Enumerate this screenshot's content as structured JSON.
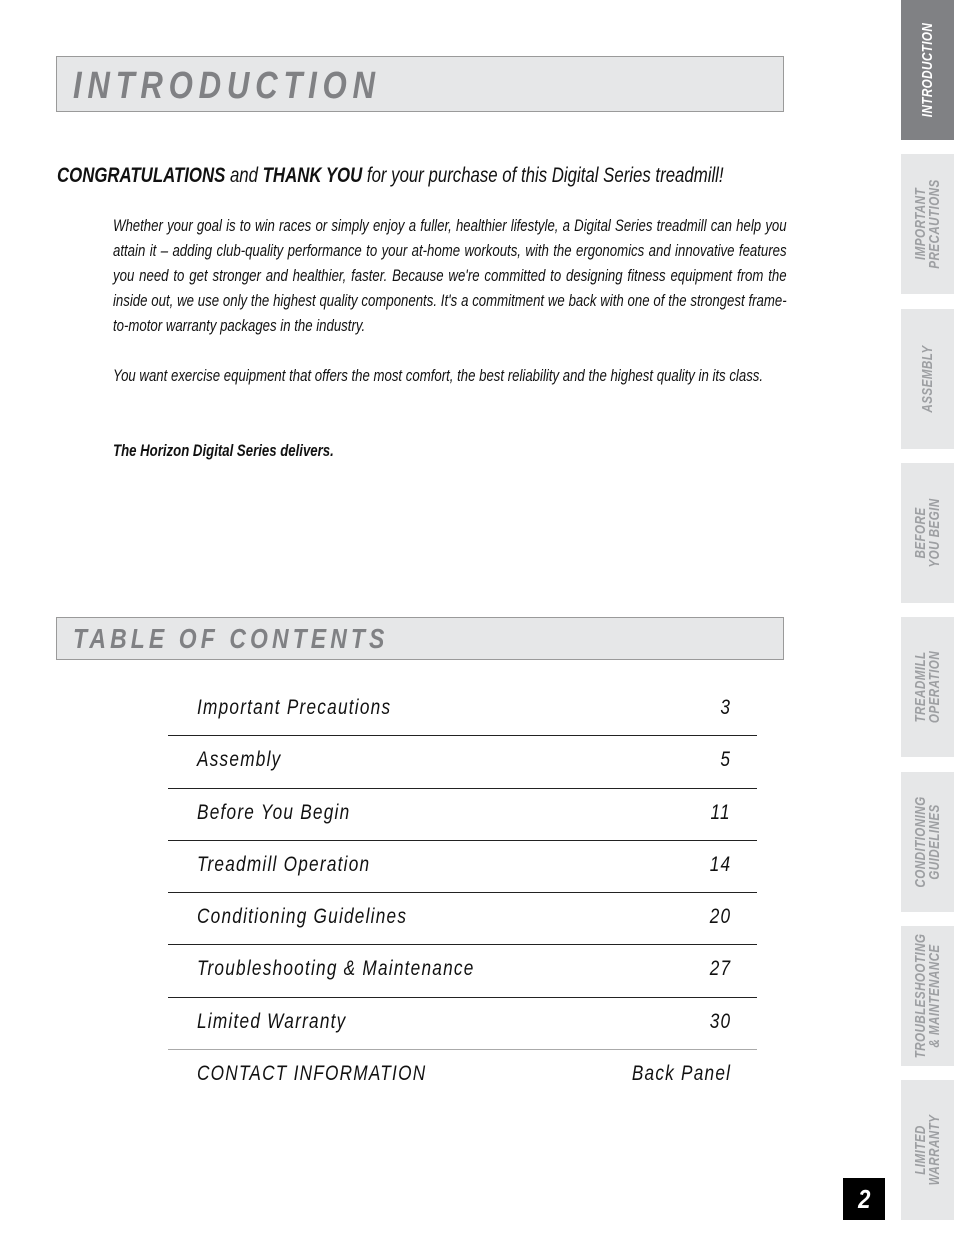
{
  "intro": {
    "title": "INTRODUCTION",
    "congrats_strong1": "CONGRATULATIONS",
    "congrats_mid": " and ",
    "congrats_strong2": "THANK YOU",
    "congrats_rest": " for your purchase of this Digital Series treadmill!",
    "paragraph1": "Whether your goal is to win races or simply enjoy a fuller, healthier lifestyle, a Digital Series treadmill can help you attain it – adding club-quality performance to your at-home workouts, with the ergonomics and innovative features you need to get stronger and healthier, faster. Because we're committed to designing fitness equipment from the inside out, we use only the highest quality components. It's a commitment we back with one of the strongest frame-to-motor warranty packages in the industry.",
    "paragraph2": "You want exercise equipment that offers the most comfort, the best reliability and the highest quality in its class.",
    "paragraph3": "The Horizon Digital Series delivers."
  },
  "toc": {
    "title": "TABLE OF CONTENTS",
    "entries": [
      {
        "label": "Important Precautions",
        "page": "3"
      },
      {
        "label": "Assembly",
        "page": "5"
      },
      {
        "label": "Before You Begin",
        "page": "11"
      },
      {
        "label": "Treadmill Operation",
        "page": "14"
      },
      {
        "label": "Conditioning Guidelines",
        "page": "20"
      },
      {
        "label": "Troubleshooting & Maintenance",
        "page": "27"
      },
      {
        "label": "Limited Warranty",
        "page": "30"
      },
      {
        "label": "CONTACT INFORMATION",
        "page": "Back Panel"
      }
    ]
  },
  "side_tabs": [
    {
      "label": "INTRODUCTION",
      "active": true
    },
    {
      "label": "IMPORTANT\nPRECAUTIONS",
      "active": false
    },
    {
      "label": "ASSEMBLY",
      "active": false
    },
    {
      "label": "BEFORE\nYOU BEGIN",
      "active": false
    },
    {
      "label": "TREADMILL\nOPERATION",
      "active": false
    },
    {
      "label": "CONDITIONING\nGUIDELINES",
      "active": false
    },
    {
      "label": "TROUBLESHOOTING\n& MAINTENANCE",
      "active": false
    },
    {
      "label": "LIMITED\nWARRANTY",
      "active": false
    }
  ],
  "page_number": "2",
  "colors": {
    "header_bg": "#e6e7e8",
    "header_text": "#808184",
    "active_tab": "#808184",
    "inactive_tab_text": "#9d9fa2"
  }
}
